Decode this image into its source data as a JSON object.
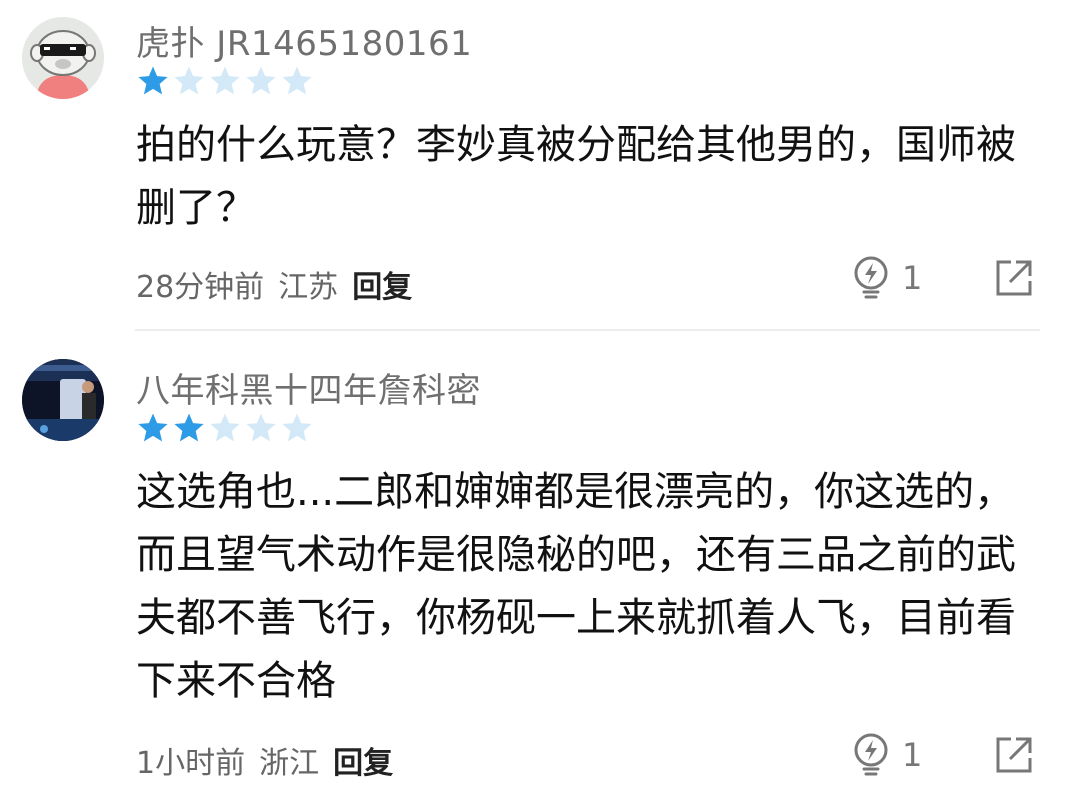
{
  "comments": [
    {
      "username": "虎扑 JR1465180161",
      "rating": 1,
      "rating_max": 5,
      "text": "拍的什么玩意？李妙真被分配给其他男的，国师被删了？",
      "time": "28分钟前",
      "location": "江苏",
      "reply_label": "回复",
      "likes": "1",
      "avatar_icon": "cartoon-sunglasses-avatar-icon"
    },
    {
      "username": "八年科黑十四年詹科密",
      "rating": 2,
      "rating_max": 5,
      "text": "这选角也...二郎和婶婶都是很漂亮的，你这选的，而且望气术动作是很隐秘的吧，还有三品之前的武夫都不善飞行，你杨砚一上来就抓着人飞，目前看下来不合格",
      "time": "1小时前",
      "location": "浙江",
      "reply_label": "回复",
      "likes": "1",
      "avatar_icon": "stage-photo-avatar-icon"
    }
  ],
  "colors": {
    "star_filled": "#2e9be6",
    "star_empty": "#d3e9f8",
    "username": "#6f6f6f",
    "meta": "#666666",
    "divider": "#ececec"
  }
}
